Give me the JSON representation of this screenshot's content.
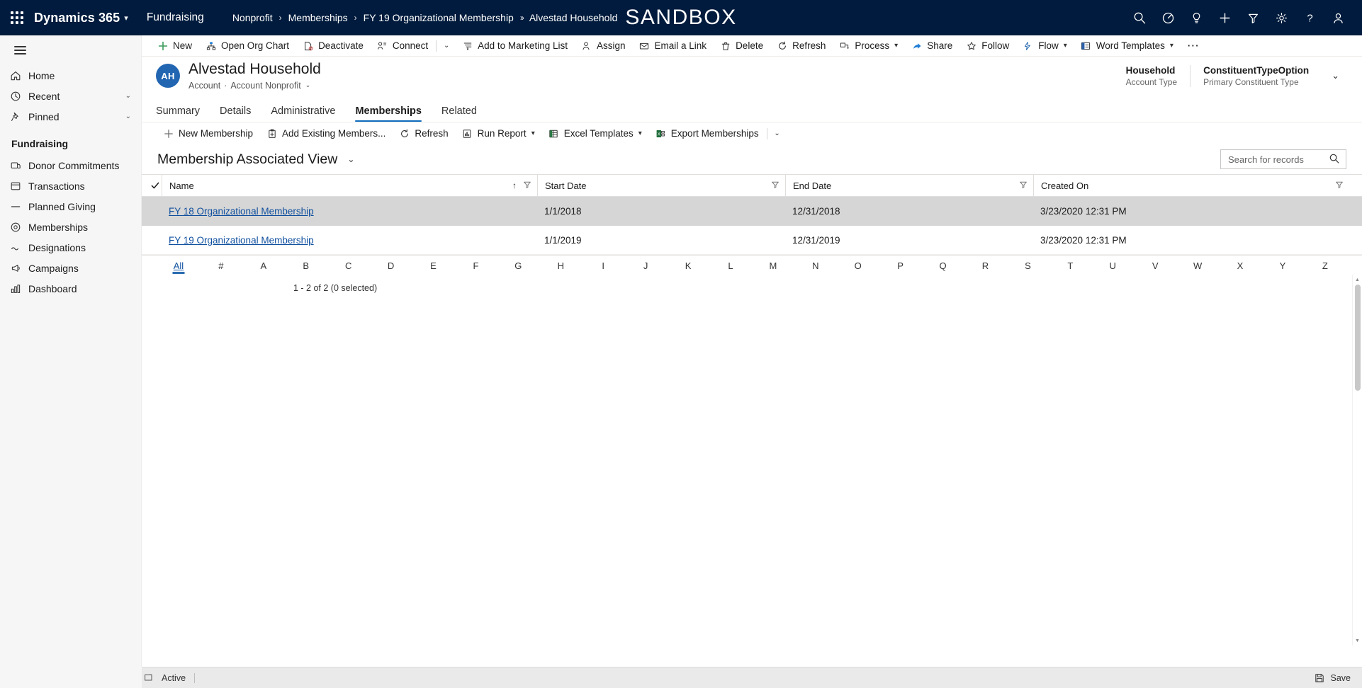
{
  "topbar": {
    "waffle_label": "App launcher",
    "brand": "Dynamics 365",
    "app_name": "Fundraising",
    "environment_banner": "SANDBOX",
    "breadcrumbs": [
      {
        "label": "Nonprofit",
        "sep": "›"
      },
      {
        "label": "Memberships",
        "sep": "›"
      },
      {
        "label": "FY 19 Organizational Membership",
        "sep": "››"
      },
      {
        "label": "Alvestad Household",
        "sep": ""
      }
    ],
    "icons": [
      {
        "name": "search-icon",
        "title": "Search"
      },
      {
        "name": "diagnostics-icon",
        "title": "Diagnostics"
      },
      {
        "name": "lightbulb-icon",
        "title": "Assistant"
      },
      {
        "name": "quick-create-icon",
        "title": "Quick Create"
      },
      {
        "name": "filter-icon",
        "title": "Relevance Search Filter"
      },
      {
        "name": "settings-gear-icon",
        "title": "Settings"
      },
      {
        "name": "help-icon",
        "title": "Help"
      },
      {
        "name": "user-avatar-icon",
        "title": "Account manager"
      }
    ]
  },
  "sidebar": {
    "toggle_label": "Site map",
    "top_items": [
      {
        "label": "Home",
        "icon": "home-icon",
        "chevron": ""
      },
      {
        "label": "Recent",
        "icon": "clock-icon",
        "chevron": "⌄"
      },
      {
        "label": "Pinned",
        "icon": "pin-icon",
        "chevron": "⌄"
      }
    ],
    "group_title": "Fundraising",
    "items": [
      {
        "label": "Donor Commitments",
        "icon": "commitment-icon"
      },
      {
        "label": "Transactions",
        "icon": "transaction-icon"
      },
      {
        "label": "Planned Giving",
        "icon": "planned-giving-icon"
      },
      {
        "label": "Memberships",
        "icon": "membership-icon"
      },
      {
        "label": "Designations",
        "icon": "designation-icon"
      },
      {
        "label": "Campaigns",
        "icon": "campaign-icon"
      },
      {
        "label": "Dashboard",
        "icon": "dashboard-icon"
      }
    ]
  },
  "commandbar": {
    "items": [
      {
        "label": "New",
        "icon": "plus-icon",
        "caret": false
      },
      {
        "label": "Open Org Chart",
        "icon": "org-chart-icon",
        "caret": false
      },
      {
        "label": "Deactivate",
        "icon": "deactivate-icon",
        "caret": false
      },
      {
        "label": "Connect",
        "icon": "connect-icon",
        "caret": false
      },
      {
        "label": "Add to Marketing List",
        "icon": "marketing-list-icon",
        "caret": false
      },
      {
        "label": "Assign",
        "icon": "assign-icon",
        "caret": false
      },
      {
        "label": "Email a Link",
        "icon": "email-link-icon",
        "caret": false
      },
      {
        "label": "Delete",
        "icon": "delete-trash-icon",
        "caret": false
      },
      {
        "label": "Refresh",
        "icon": "refresh-icon",
        "caret": false
      },
      {
        "label": "Process",
        "icon": "process-icon",
        "caret": true
      },
      {
        "label": "Share",
        "icon": "share-icon",
        "caret": false
      },
      {
        "label": "Follow",
        "icon": "follow-star-icon",
        "caret": false
      },
      {
        "label": "Flow",
        "icon": "flow-icon",
        "caret": true
      },
      {
        "label": "Word Templates",
        "icon": "word-template-icon",
        "caret": true
      }
    ],
    "connect_split_caret": "⌄",
    "overflow_label": "⋯"
  },
  "record_header": {
    "avatar_initials": "AH",
    "title": "Alvestad Household",
    "subtitle_entity": "Account",
    "subtitle_sep": "·",
    "subtitle_form": "Account Nonprofit",
    "form_caret": "⌄",
    "fields": [
      {
        "value": "Household",
        "label": "Account Type"
      },
      {
        "value": "ConstituentTypeOption",
        "label": "Primary Constituent Type"
      }
    ],
    "expand_caret": "⌄"
  },
  "tabs": [
    {
      "label": "Summary",
      "active": false
    },
    {
      "label": "Details",
      "active": false
    },
    {
      "label": "Administrative",
      "active": false
    },
    {
      "label": "Memberships",
      "active": true
    },
    {
      "label": "Related",
      "active": false
    }
  ],
  "subgrid": {
    "toolbar": [
      {
        "label": "New Membership",
        "icon": "plus-icon",
        "caret": false
      },
      {
        "label": "Add Existing Members...",
        "icon": "add-existing-icon",
        "caret": false
      },
      {
        "label": "Refresh",
        "icon": "refresh-icon",
        "caret": false
      },
      {
        "label": "Run Report",
        "icon": "report-icon",
        "caret": true
      },
      {
        "label": "Excel Templates",
        "icon": "excel-icon",
        "caret": true
      },
      {
        "label": "Export Memberships",
        "icon": "export-excel-icon",
        "caret": false
      }
    ],
    "toolbar_overflow_caret": "⌄",
    "view_name": "Membership Associated View",
    "view_caret": "⌄",
    "search": {
      "placeholder": "Search for records",
      "value": "",
      "icon": "search-icon"
    },
    "columns": [
      {
        "label": "Name",
        "sort": "↑",
        "filter": true
      },
      {
        "label": "Start Date",
        "sort": "",
        "filter": true
      },
      {
        "label": "End Date",
        "sort": "",
        "filter": true
      },
      {
        "label": "Created On",
        "sort": "",
        "filter": true
      }
    ],
    "select_all_icon": "checkmark-icon",
    "rows": [
      {
        "name": "FY 18 Organizational Membership",
        "start_date": "1/1/2018",
        "end_date": "12/31/2018",
        "created_on": "3/23/2020 12:31 PM",
        "hovered": true
      },
      {
        "name": "FY 19 Organizational Membership",
        "start_date": "1/1/2019",
        "end_date": "12/31/2019",
        "created_on": "3/23/2020 12:31 PM",
        "hovered": false
      }
    ],
    "alphabet": [
      "All",
      "#",
      "A",
      "B",
      "C",
      "D",
      "E",
      "F",
      "G",
      "H",
      "I",
      "J",
      "K",
      "L",
      "M",
      "N",
      "O",
      "P",
      "Q",
      "R",
      "S",
      "T",
      "U",
      "V",
      "W",
      "X",
      "Y",
      "Z"
    ],
    "alphabet_active": "All",
    "record_count": "1 - 2 of 2 (0 selected)"
  },
  "footer": {
    "resize_icon": "resize-icon",
    "status": "Active",
    "save_label": "Save",
    "save_icon": "save-icon"
  },
  "colors": {
    "nav_background": "#001b3d",
    "accent": "#0f6cbd",
    "avatar": "#2266b2",
    "link": "#0f4f9e",
    "sidebar_background": "#f6f6f6",
    "row_hover": "#d6d6d6",
    "footer_background": "#eaeaea"
  }
}
